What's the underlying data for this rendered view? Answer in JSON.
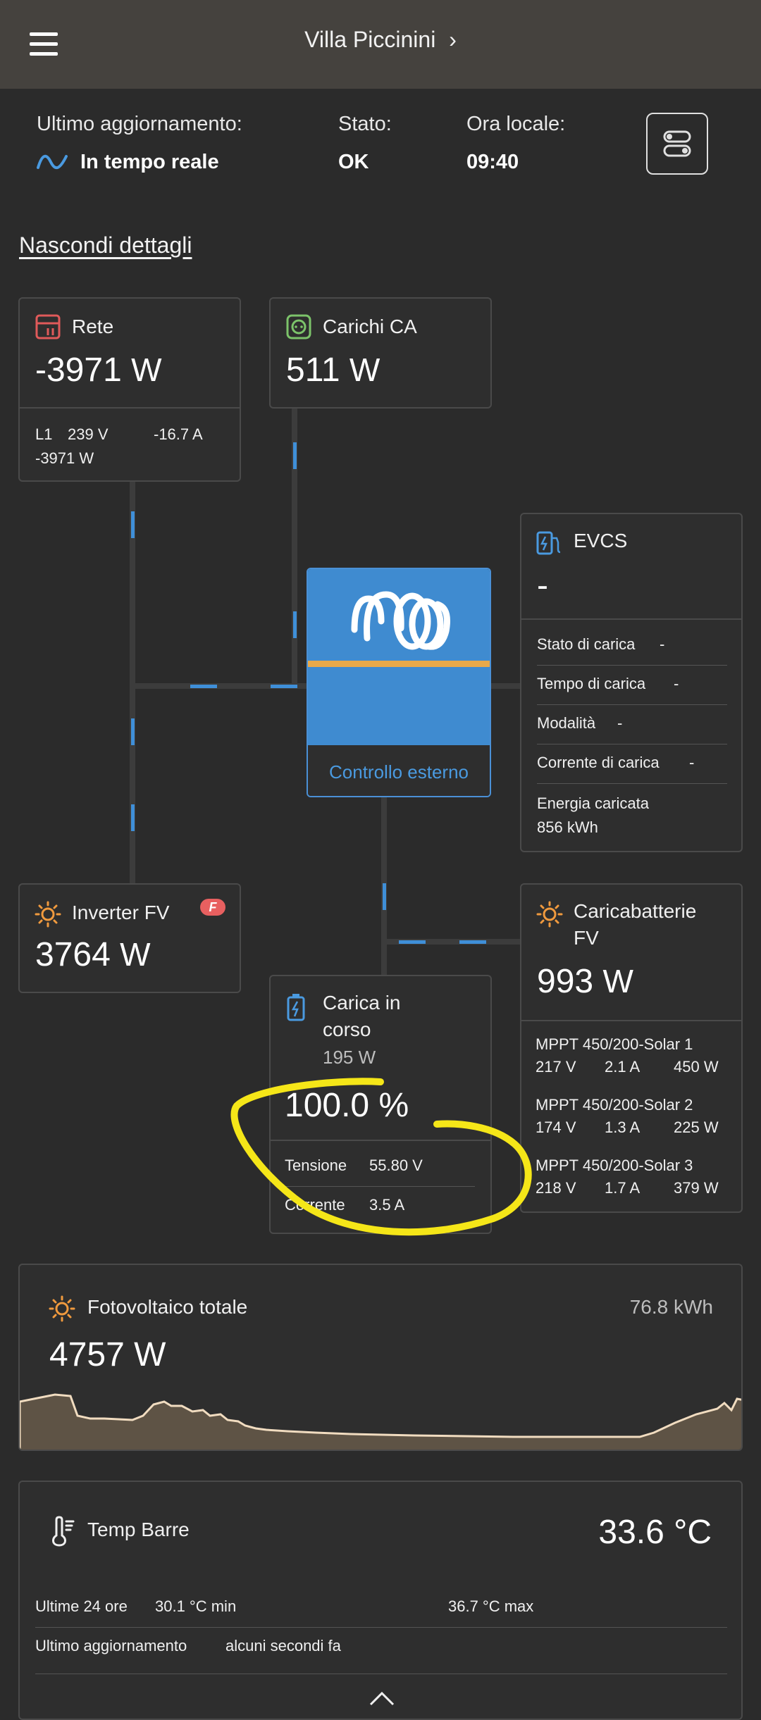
{
  "header": {
    "title": "Villa Piccinini",
    "chevron": "›"
  },
  "status": {
    "last_update_label": "Ultimo aggiornamento:",
    "last_update_value": "In tempo reale",
    "state_label": "Stato:",
    "state_value": "OK",
    "local_time_label": "Ora locale:",
    "local_time_value": "09:40"
  },
  "hide_details": "Nascondi dettagli",
  "grid": {
    "name": "Rete",
    "power": "-3971",
    "unit": "W",
    "l1_label": "L1",
    "l1_voltage": "239 V",
    "l1_current": "-16.7 A",
    "l1_power": "-3971 W"
  },
  "ac_loads": {
    "name": "Carichi CA",
    "power": "511",
    "unit": "W"
  },
  "evcs": {
    "name": "EVCS",
    "value": "-",
    "rows": [
      {
        "label": "Stato di carica",
        "value": "-"
      },
      {
        "label": "Tempo di carica",
        "value": "-"
      },
      {
        "label": "Modalità",
        "value": "-"
      },
      {
        "label": "Corrente di carica",
        "value": "-"
      }
    ],
    "energy_label": "Energia caricata",
    "energy_value": "856 kWh"
  },
  "inverter_unit": {
    "label": "Controllo esterno"
  },
  "pv_inverter": {
    "name": "Inverter FV",
    "power": "3764",
    "unit": "W",
    "badge": "F"
  },
  "battery": {
    "name_line1": "Carica in",
    "name_line2": "corso",
    "power": "195 W",
    "soc": "100.0 %",
    "voltage_label": "Tensione",
    "voltage": "55.80 V",
    "current_label": "Corrente",
    "current": "3.5 A"
  },
  "pv_charger": {
    "name_line1": "Caricabatterie",
    "name_line2": "FV",
    "power": "993",
    "unit": "W",
    "chargers": [
      {
        "name": "MPPT 450/200-Solar 1",
        "voltage": "217 V",
        "current": "2.1 A",
        "power": "450 W"
      },
      {
        "name": "MPPT 450/200-Solar 2",
        "voltage": "174 V",
        "current": "1.3 A",
        "power": "225 W"
      },
      {
        "name": "MPPT 450/200-Solar 3",
        "voltage": "218 V",
        "current": "1.7 A",
        "power": "379 W"
      }
    ]
  },
  "pv_total": {
    "name": "Fotovoltaico totale",
    "energy": "76.8 kWh",
    "power": "4757 W"
  },
  "temp": {
    "name": "Temp Barre",
    "value": "33.6 °C",
    "last24_label": "Ultime 24 ore",
    "min": "30.1 °C min",
    "max": "36.7 °C max",
    "update_label": "Ultimo aggiornamento",
    "update_value": "alcuni secondi fa"
  },
  "colors": {
    "accent_blue": "#3f8fd8",
    "grid_red": "#e05a5a",
    "loads_green": "#7cc36a",
    "solar_orange": "#f09a3e",
    "annotation_yellow": "#f5e618"
  }
}
